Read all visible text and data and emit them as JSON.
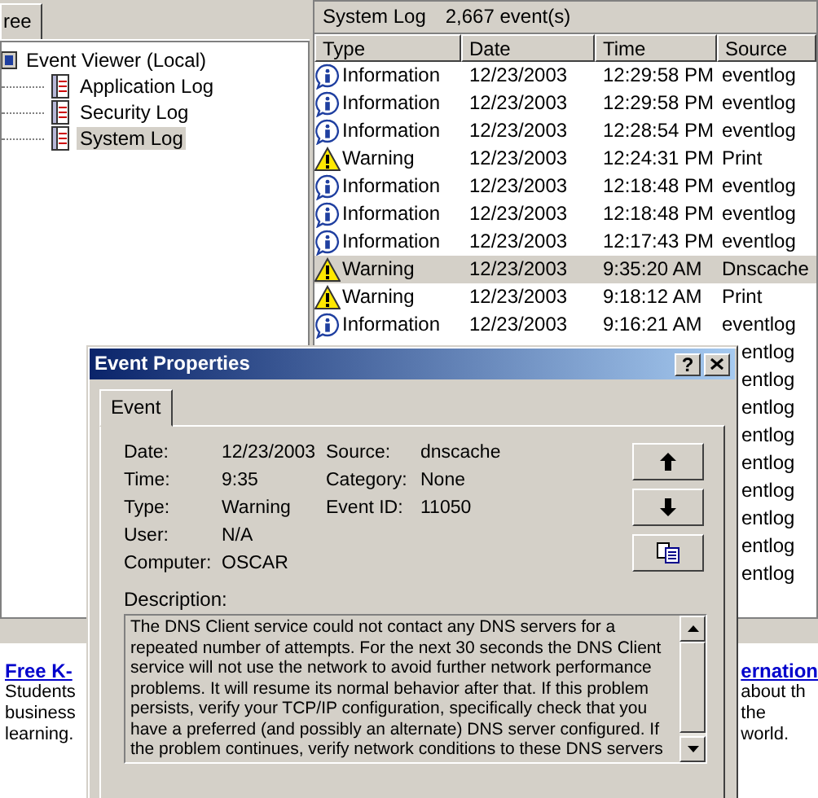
{
  "tree_panel": {
    "tab": {
      "label": "ree",
      "selected": true
    },
    "root": {
      "label": "Event Viewer (Local)",
      "children": [
        {
          "label": "Application Log",
          "selected": false
        },
        {
          "label": "Security Log",
          "selected": false
        },
        {
          "label": "System Log",
          "selected": true
        }
      ]
    }
  },
  "log_panel": {
    "title": "System Log",
    "count": "2,667 event(s)",
    "columns": [
      "Type",
      "Date",
      "Time",
      "Source"
    ],
    "rows": [
      {
        "kind": "information",
        "type": "Information",
        "date": "12/23/2003",
        "time": "12:29:58 PM",
        "source": "eventlog",
        "selected": false
      },
      {
        "kind": "information",
        "type": "Information",
        "date": "12/23/2003",
        "time": "12:29:58 PM",
        "source": "eventlog",
        "selected": false
      },
      {
        "kind": "information",
        "type": "Information",
        "date": "12/23/2003",
        "time": "12:28:54 PM",
        "source": "eventlog",
        "selected": false
      },
      {
        "kind": "warning",
        "type": "Warning",
        "date": "12/23/2003",
        "time": "12:24:31 PM",
        "source": "Print",
        "selected": false
      },
      {
        "kind": "information",
        "type": "Information",
        "date": "12/23/2003",
        "time": "12:18:48 PM",
        "source": "eventlog",
        "selected": false
      },
      {
        "kind": "information",
        "type": "Information",
        "date": "12/23/2003",
        "time": "12:18:48 PM",
        "source": "eventlog",
        "selected": false
      },
      {
        "kind": "information",
        "type": "Information",
        "date": "12/23/2003",
        "time": "12:17:43 PM",
        "source": "eventlog",
        "selected": false
      },
      {
        "kind": "warning",
        "type": "Warning",
        "date": "12/23/2003",
        "time": "9:35:20 AM",
        "source": "Dnscache",
        "selected": true
      },
      {
        "kind": "warning",
        "type": "Warning",
        "date": "12/23/2003",
        "time": "9:18:12 AM",
        "source": "Print",
        "selected": false
      },
      {
        "kind": "information",
        "type": "Information",
        "date": "12/23/2003",
        "time": "9:16:21 AM",
        "source": "eventlog",
        "selected": false
      }
    ],
    "covered_rows": [
      {
        "source": "entlog"
      },
      {
        "source": "entlog"
      },
      {
        "source": "entlog"
      },
      {
        "source": "entlog"
      },
      {
        "source": "entlog"
      },
      {
        "source": "entlog"
      },
      {
        "source": "entlog"
      },
      {
        "source": "entlog"
      },
      {
        "source": "entlog"
      }
    ]
  },
  "web_page": {
    "left": {
      "link": "Free K-",
      "lines": [
        "Students",
        "business",
        "learning."
      ]
    },
    "right": {
      "link": "ernation",
      "lines": [
        "about th",
        "the",
        "world."
      ]
    }
  },
  "dialog": {
    "title": "Event Properties",
    "help_button": "?",
    "tabs": [
      {
        "label": "Event",
        "selected": true
      }
    ],
    "fields_left": [
      {
        "label": "Date:",
        "value": "12/23/2003"
      },
      {
        "label": "Time:",
        "value": "9:35"
      },
      {
        "label": "Type:",
        "value": "Warning"
      },
      {
        "label": "User:",
        "value": "N/A"
      },
      {
        "label": "Computer:",
        "value": "OSCAR"
      }
    ],
    "fields_right": [
      {
        "label": "Source:",
        "value": "dnscache"
      },
      {
        "label": "Category:",
        "value": "None"
      },
      {
        "label": "Event ID:",
        "value": "11050"
      }
    ],
    "description_label": "Description:",
    "description": "The DNS Client service could not contact any DNS servers for a repeated number of attempts. For the next 30 seconds the DNS Client service will not use the network to avoid further network performance problems. It will resume its normal behavior after that. If this problem persists, verify your TCP/IP configuration, specifically check that you have a preferred (and possibly an alternate) DNS server configured. If the problem continues, verify network conditions to these DNS servers"
  }
}
